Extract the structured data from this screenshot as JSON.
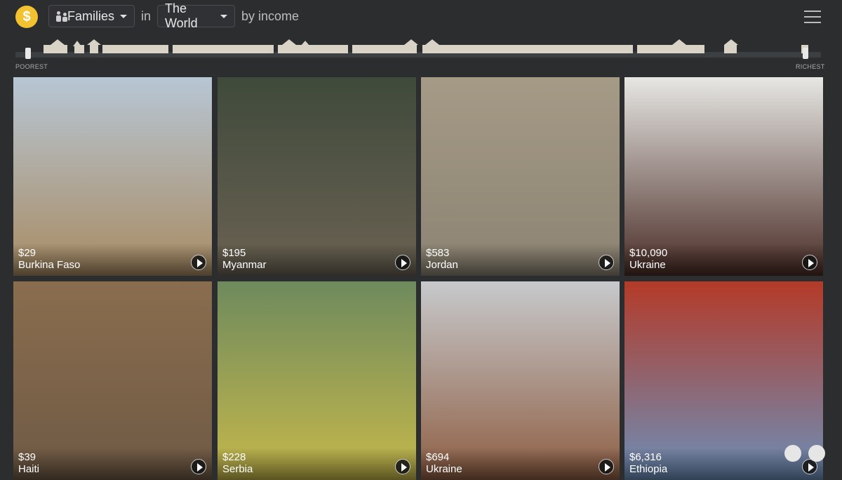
{
  "header": {
    "logo": "$",
    "families_label": "Families",
    "in_label": "in",
    "region_label": "The World",
    "by_label": "by income"
  },
  "income_strip": {
    "poorest_label": "POOREST",
    "richest_label": "RICHEST"
  },
  "cards": [
    {
      "income": "$29",
      "country": "Burkina Faso",
      "colors": [
        "#b7c6d4",
        "#a88b63"
      ]
    },
    {
      "income": "$195",
      "country": "Myanmar",
      "colors": [
        "#3f4a3b",
        "#6b6253"
      ]
    },
    {
      "income": "$583",
      "country": "Jordan",
      "colors": [
        "#a59a86",
        "#8c8373"
      ]
    },
    {
      "income": "$10,090",
      "country": "Ukraine",
      "colors": [
        "#e7e7e4",
        "#4a2c26"
      ]
    },
    {
      "income": "$39",
      "country": "Haiti",
      "colors": [
        "#8a6d4e",
        "#6f5a45"
      ]
    },
    {
      "income": "$228",
      "country": "Serbia",
      "colors": [
        "#6e8a5d",
        "#c6b84b"
      ]
    },
    {
      "income": "$694",
      "country": "Ukraine",
      "colors": [
        "#c7c9cc",
        "#8e5e43"
      ]
    },
    {
      "income": "$6,316",
      "country": "Ethiopia",
      "colors": [
        "#b43a28",
        "#6c8fb8"
      ]
    }
  ]
}
